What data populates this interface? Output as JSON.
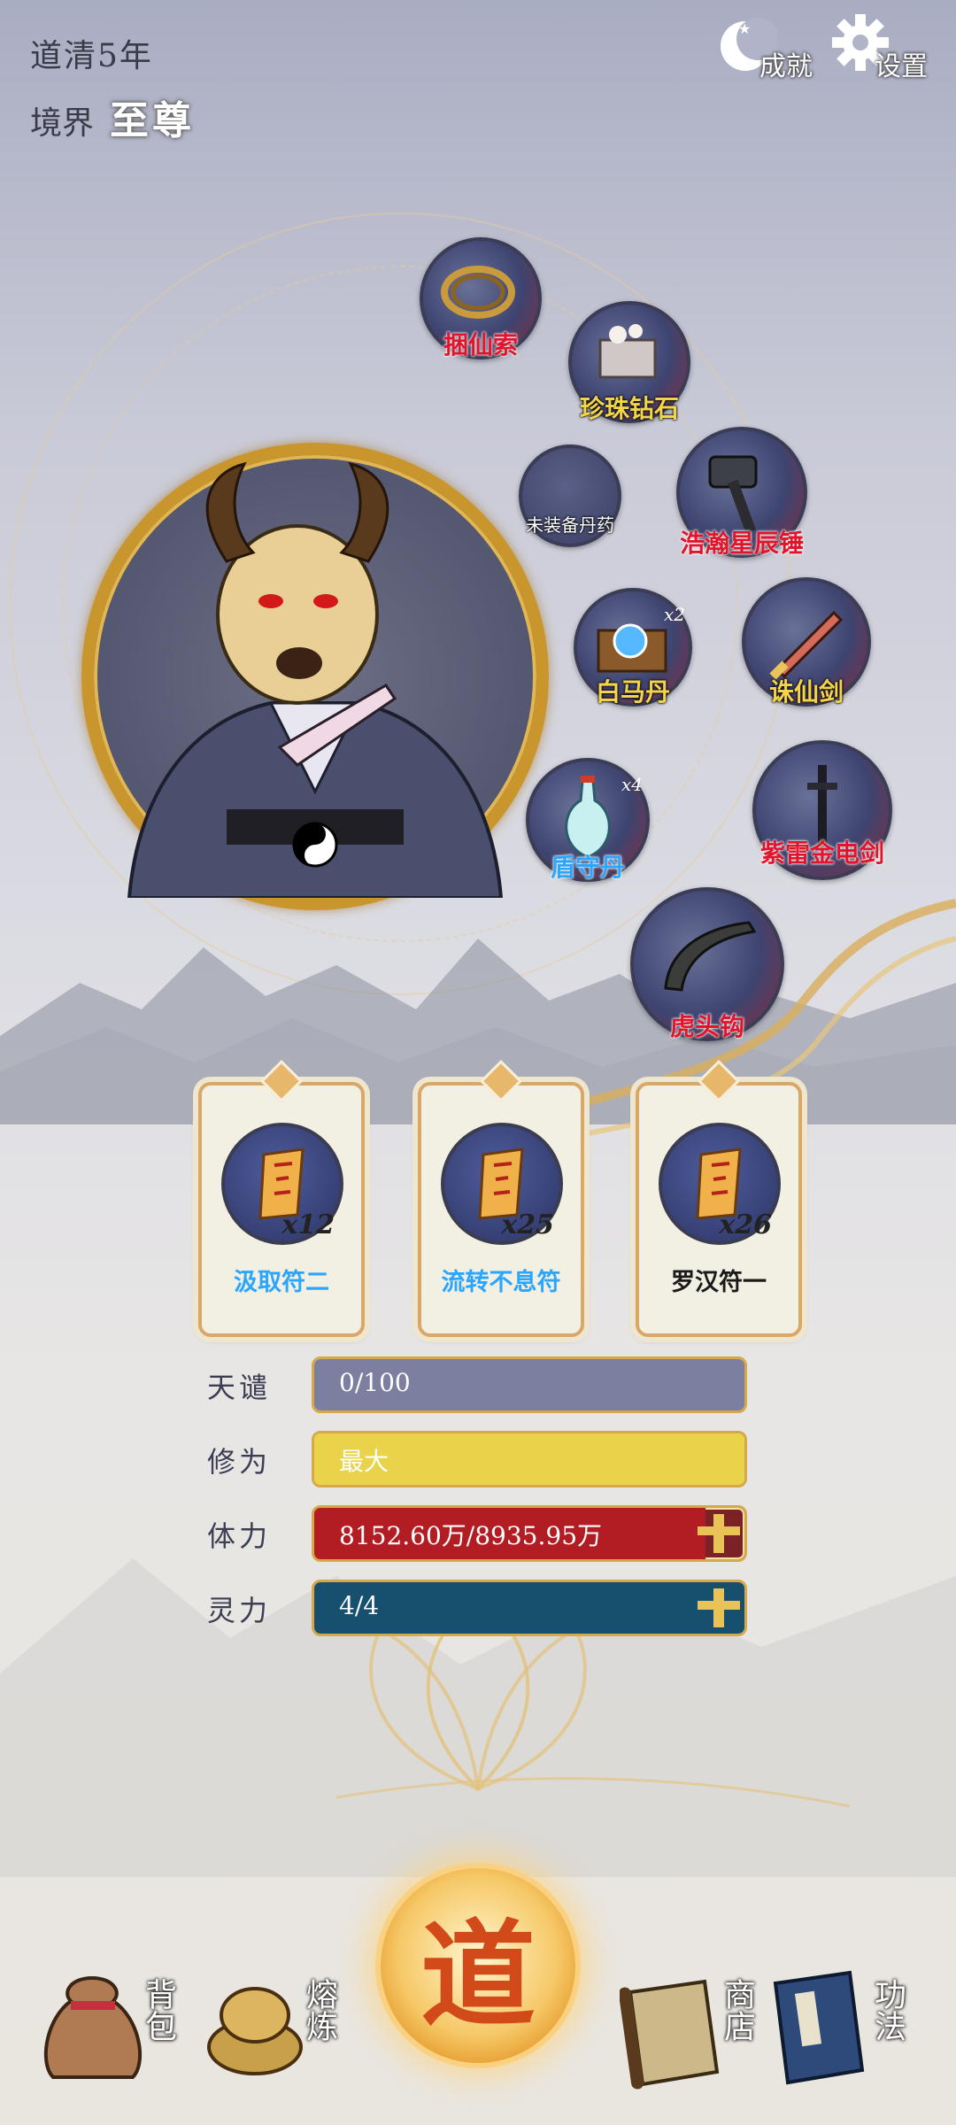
{
  "header": {
    "year": "道清5年",
    "realm_label": "境界",
    "realm_value": "至尊",
    "achievement_label": "成就",
    "settings_label": "设置"
  },
  "equipment": [
    {
      "name": "捆仙索",
      "icon": "rope-icon",
      "style": "red"
    },
    {
      "name": "珍珠钻石",
      "icon": "gem-icon",
      "style": "gold"
    },
    {
      "name": "未装备丹药",
      "icon": "empty-slot-icon",
      "style": "white"
    },
    {
      "name": "浩瀚星辰锤",
      "icon": "hammer-icon",
      "style": "red"
    },
    {
      "name": "白马丹",
      "icon": "chest-orb-icon",
      "style": "gold",
      "count": "x2"
    },
    {
      "name": "诛仙剑",
      "icon": "sword-icon",
      "style": "gold"
    },
    {
      "name": "盾守丹",
      "icon": "vase-icon",
      "style": "blue",
      "count": "x4"
    },
    {
      "name": "紫雷金电剑",
      "icon": "dark-sword-icon",
      "style": "red"
    },
    {
      "name": "虎头钩",
      "icon": "hook-icon",
      "style": "red"
    }
  ],
  "talismans": [
    {
      "name": "汲取符二",
      "count": "x12",
      "style": "blue"
    },
    {
      "name": "流转不息符",
      "count": "x25",
      "style": "blue"
    },
    {
      "name": "罗汉符一",
      "count": "x26",
      "style": "black"
    }
  ],
  "stats": {
    "tianqian": {
      "label": "天谴",
      "value": "0/100",
      "fill": 1.0,
      "color": "#7d7fa0"
    },
    "xiuwei": {
      "label": "修为",
      "value": "最大",
      "fill": 1.0,
      "color": "#e9d34a"
    },
    "tili": {
      "label": "体力",
      "value": "8152.60万/8935.95万",
      "fill": 0.91,
      "color": "#b21c23"
    },
    "lingli": {
      "label": "灵力",
      "value": "4/4",
      "fill": 1.0,
      "color": "#17506e"
    }
  },
  "nav": {
    "bag": "背包",
    "refine": "熔炼",
    "dao": "道",
    "shop": "商店",
    "skills": "功法"
  }
}
